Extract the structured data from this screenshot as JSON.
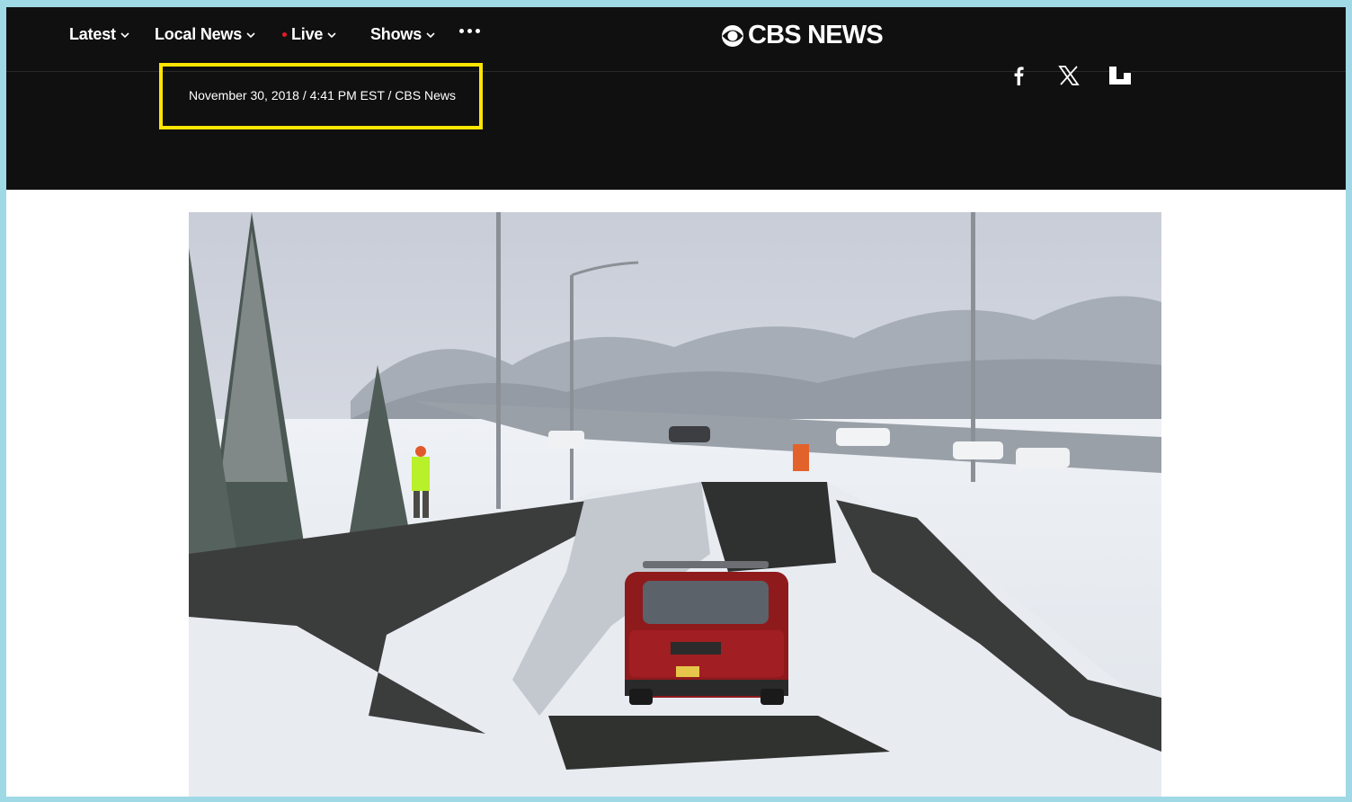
{
  "nav": {
    "items": [
      {
        "label": "Latest"
      },
      {
        "label": "Local News"
      },
      {
        "label": "Live"
      },
      {
        "label": "Shows"
      }
    ],
    "more_icon": "more-dots-icon",
    "live_dot_color": "#e31b23"
  },
  "logo": {
    "text": "CBS NEWS",
    "icon": "cbs-eye-icon"
  },
  "article": {
    "byline": "November 30, 2018 / 4:41 PM EST / CBS News",
    "share_icons": [
      "facebook-icon",
      "x-icon",
      "flipboard-icon"
    ]
  },
  "colors": {
    "header_bg": "#101010",
    "highlight": "#ffe500",
    "page_border": "#9fd9e6"
  }
}
